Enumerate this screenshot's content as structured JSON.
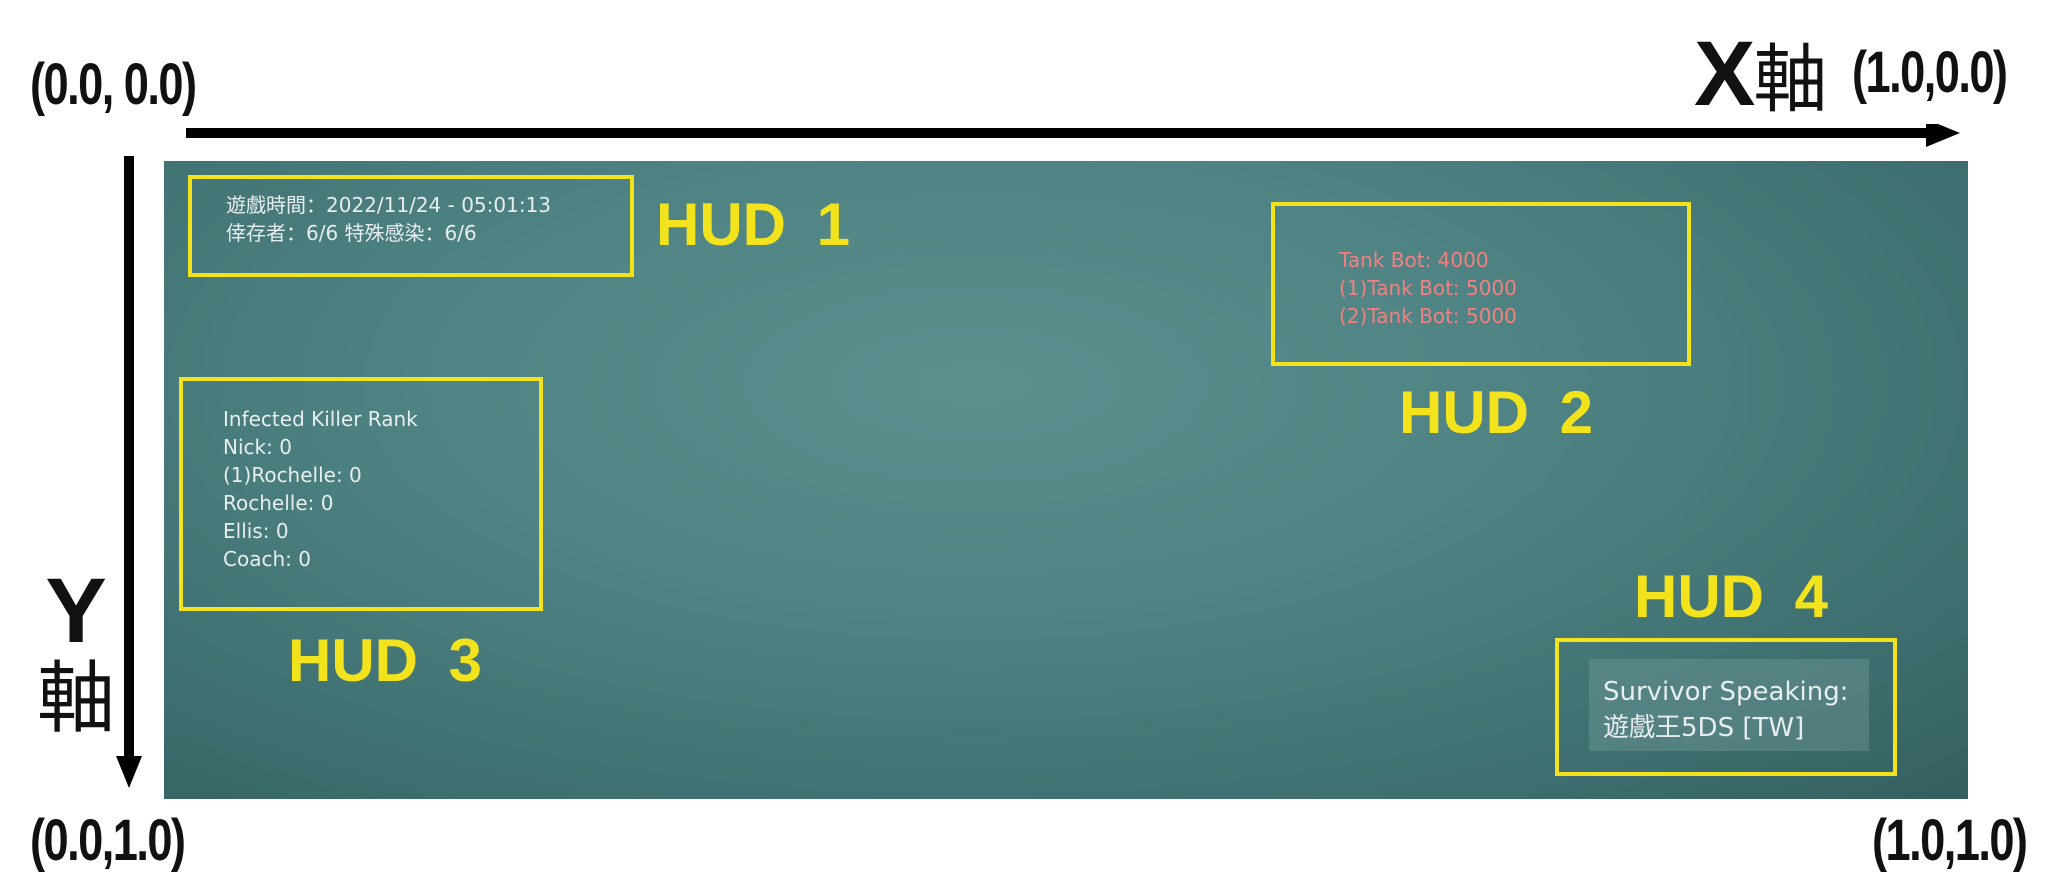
{
  "corners": {
    "top_left": "(0.0, 0.0)",
    "top_right": "(1.0,0.0)",
    "bottom_left": "(0.0,1.0)",
    "bottom_right": "(1.0,1.0)"
  },
  "axes": {
    "x_letter": "X",
    "x_kanji": "軸",
    "y_letter": "Y",
    "y_kanji": "軸"
  },
  "colors": {
    "hud_frame": "#f2e31c",
    "screen_bg": "#4f8383",
    "tank_text": "#f28080"
  },
  "hud1": {
    "label": "HUD 1",
    "lines": [
      "遊戲時間：2022/11/24 - 05:01:13",
      "倖存者：6/6  特殊感染：6/6"
    ]
  },
  "hud2": {
    "label": "HUD 2",
    "lines": [
      "Tank Bot: 4000",
      "(1)Tank Bot: 5000",
      "(2)Tank Bot: 5000"
    ]
  },
  "hud3": {
    "label": "HUD 3",
    "lines": [
      "Infected Killer Rank",
      "Nick: 0",
      "(1)Rochelle: 0",
      "Rochelle: 0",
      "Ellis: 0",
      "Coach: 0"
    ]
  },
  "hud4": {
    "label": "HUD 4",
    "lines": [
      "Survivor Speaking:",
      "遊戲王5DS [TW]"
    ]
  }
}
